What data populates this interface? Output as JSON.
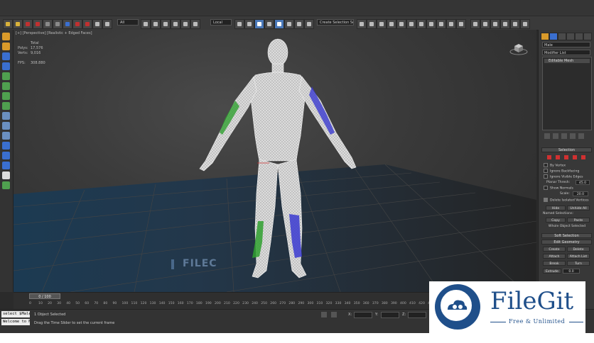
{
  "toolbar": {
    "filter_value": "All",
    "ref_coord_value": "Local",
    "selection_set_placeholder": "Create Selection Se"
  },
  "viewport": {
    "label": "[+] [Perspective] [Realistic + Edged Faces]",
    "stats": {
      "header": "Total",
      "polys_label": "Polys:",
      "polys_value": "17,576",
      "verts_label": "Verts:",
      "verts_value": "9,016",
      "fps_label": "FPS:",
      "fps_value": "308.880"
    },
    "watermark": "FILEC"
  },
  "command_panel": {
    "object_name": "Male",
    "modifier_list": "Modifier List",
    "stack_item": "Editable Mesh",
    "selection_rollout": "Selection",
    "by_vertex": "By Vertex",
    "ignore_backfacing": "Ignore Backfacing",
    "ignore_visible_edges": "Ignore Visible Edges",
    "planar_thresh_label": "Planar Thresh:",
    "planar_thresh_value": "45.0",
    "show_normals": "Show Normals",
    "scale_label": "Scale:",
    "scale_value": "20.0",
    "delete_isolated": "Delete Isolated Vertices",
    "hide_btn": "Hide",
    "unhide_all_btn": "Unhide All",
    "named_selections": "Named Selections:",
    "copy_btn": "Copy",
    "paste_btn": "Paste",
    "whole_object": "Whole Object Selected",
    "soft_selection": "Soft Selection",
    "edit_geometry": "Edit Geometry",
    "create_btn": "Create",
    "delete_btn": "Delete",
    "attach_btn": "Attach",
    "attach_list_btn": "Attach List",
    "break_btn": "Break",
    "turn_btn": "Turn",
    "extrude_btn": "Extrude",
    "extrude_value": "0.0"
  },
  "timeline": {
    "slider_label": "0 / 100",
    "ticks": [
      "0",
      "10",
      "20",
      "30",
      "40",
      "50",
      "60",
      "70",
      "80",
      "90",
      "100",
      "110",
      "120",
      "130",
      "140",
      "150",
      "160",
      "170",
      "180",
      "190",
      "200",
      "210",
      "220",
      "230",
      "240",
      "250",
      "260",
      "270",
      "280",
      "290",
      "300",
      "310",
      "320",
      "330",
      "340",
      "350",
      "360",
      "370",
      "380",
      "390",
      "400",
      "410",
      "420",
      "430",
      "440",
      "450",
      "460",
      "470",
      "480"
    ]
  },
  "status": {
    "listener_line1": "select $Male",
    "listener_line2": "Welcome to M",
    "selection_status": "1 Object Selected",
    "prompt": "Drag the Time Slider to set the current frame",
    "x_label": "X:",
    "y_label": "Y:",
    "z_label": "Z:"
  },
  "filegit": {
    "title": "FileGit",
    "subtitle": "Free & Unlimited"
  },
  "colors": {
    "filegit_blue": "#1f4f8a",
    "mesh_white": "#e8e8e8",
    "green_map": "#2fa02f",
    "blue_map": "#3a3ad0"
  }
}
